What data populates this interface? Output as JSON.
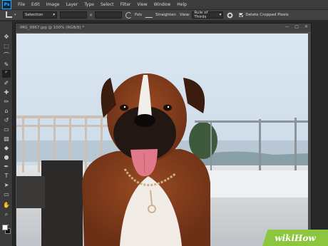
{
  "menubar": {
    "logo": "Ps",
    "items": [
      "File",
      "Edit",
      "Image",
      "Layer",
      "Type",
      "Select",
      "Filter",
      "View",
      "Window",
      "Help"
    ]
  },
  "options": {
    "preset": "Selection",
    "swap_symbol": "×",
    "clear_label": "Pxls",
    "straighten_label": "Straighten",
    "view_label": "View:",
    "view_value": "Rule of Thirds",
    "delete_cropped_label": "Delete Cropped Pixels",
    "delete_cropped_checked": true
  },
  "document": {
    "tab_title": "IMG_9967.jpg @ 100% (RGB/8) *"
  },
  "tools": [
    {
      "name": "move-tool-icon",
      "glyph": "✥"
    },
    {
      "name": "marquee-tool-icon",
      "glyph": "⬚"
    },
    {
      "name": "lasso-tool-icon",
      "glyph": "⌒"
    },
    {
      "name": "quick-select-tool-icon",
      "glyph": "✎"
    },
    {
      "name": "crop-tool-icon",
      "glyph": "⌜"
    },
    {
      "name": "eyedropper-tool-icon",
      "glyph": "✐"
    },
    {
      "name": "healing-brush-tool-icon",
      "glyph": "✚"
    },
    {
      "name": "brush-tool-icon",
      "glyph": "✏"
    },
    {
      "name": "clone-stamp-tool-icon",
      "glyph": "⌂"
    },
    {
      "name": "history-brush-tool-icon",
      "glyph": "↺"
    },
    {
      "name": "eraser-tool-icon",
      "glyph": "▭"
    },
    {
      "name": "gradient-tool-icon",
      "glyph": "▨"
    },
    {
      "name": "blur-tool-icon",
      "glyph": "◆"
    },
    {
      "name": "dodge-tool-icon",
      "glyph": "●"
    },
    {
      "name": "pen-tool-icon",
      "glyph": "✒"
    },
    {
      "name": "type-tool-icon",
      "glyph": "T"
    },
    {
      "name": "path-select-tool-icon",
      "glyph": "➤"
    },
    {
      "name": "shape-tool-icon",
      "glyph": "▭"
    },
    {
      "name": "hand-tool-icon",
      "glyph": "✋"
    },
    {
      "name": "zoom-tool-icon",
      "glyph": "⌕"
    },
    {
      "name": "more-tools-icon",
      "glyph": "…"
    }
  ],
  "colors": {
    "foreground": "#ffffff",
    "background": "#111111"
  },
  "watermark": "wikiHow"
}
